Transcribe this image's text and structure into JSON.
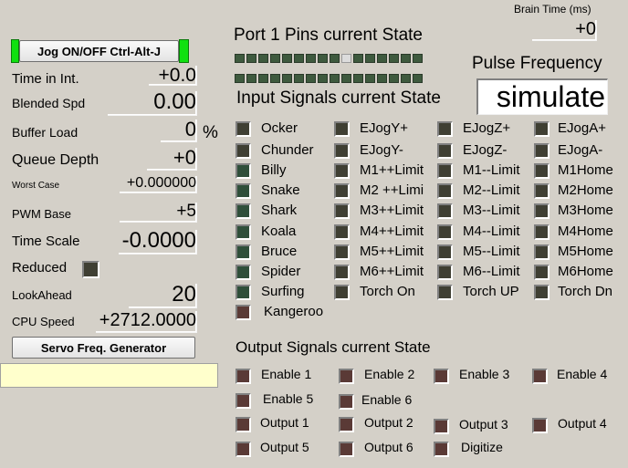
{
  "left": {
    "jog_button": "Jog ON/OFF Ctrl-Alt-J",
    "time_in_int": {
      "label": "Time in Int.",
      "value": "+0.0"
    },
    "blended_spd": {
      "label": "Blended Spd",
      "value": "0.00"
    },
    "buffer_load": {
      "label": "Buffer Load",
      "value": "0",
      "unit": "%"
    },
    "queue_depth": {
      "label": "Queue Depth",
      "value": "+0"
    },
    "worst_case": {
      "label": "Worst Case",
      "value": "+0.000000"
    },
    "pwm_base": {
      "label": "PWM Base",
      "value": "+5"
    },
    "time_scale": {
      "label": "Time Scale",
      "value": "-0.0000"
    },
    "reduced": {
      "label": "Reduced"
    },
    "lookahead": {
      "label": "LookAhead",
      "value": "20"
    },
    "cpu_speed": {
      "label": "CPU Speed",
      "value": "+2712.0000"
    },
    "servo_button": "Servo Freq. Generator"
  },
  "top": {
    "brain_time": {
      "label": "Brain Time (ms)",
      "value": "+0"
    },
    "port_title": "Port 1 Pins current State",
    "input_title": "Input Signals current State",
    "pulse_title": "Pulse Frequency",
    "pulse_value": "simulate"
  },
  "inputs": {
    "col1": [
      "Ocker",
      "Chunder",
      "Billy",
      "Snake",
      "Shark",
      "Koala",
      "Bruce",
      "Spider",
      "Surfing",
      "Kangeroo"
    ],
    "col2": [
      "EJogY+",
      "EJogY-",
      "M1++Limit",
      "M2 ++Limi",
      "M3++Limit",
      "M4++Limit",
      "M5++Limit",
      "M6++Limit",
      "Torch On"
    ],
    "col3": [
      "EJogZ+",
      "EJogZ-",
      "M1--Limit",
      "M2--Limit",
      "M3--Limit",
      "M4--Limit",
      "M5--Limit",
      "M6--Limit",
      "Torch UP"
    ],
    "col4": [
      "EJogA+",
      "EJogA-",
      "M1Home",
      "M2Home",
      "M3Home",
      "M4Home",
      "M5Home",
      "M6Home",
      "Torch Dn"
    ]
  },
  "outputs": {
    "title": "Output Signals current State",
    "items": [
      "Enable 1",
      "Enable 2",
      "Enable 3",
      "Enable 4",
      "Enable 5",
      "Enable 6",
      "Output 1",
      "Output 2",
      "Output 3",
      "Output 4",
      "Output 5",
      "Output 6",
      "Digitize"
    ]
  },
  "colors": {
    "background": "#d4d0c8",
    "led_green": "#2f4f3a",
    "led_dark": "#3f3f33",
    "led_output": "#5a3a36",
    "jog_indicator": "#10e010",
    "yellow_box": "#ffffcc"
  }
}
